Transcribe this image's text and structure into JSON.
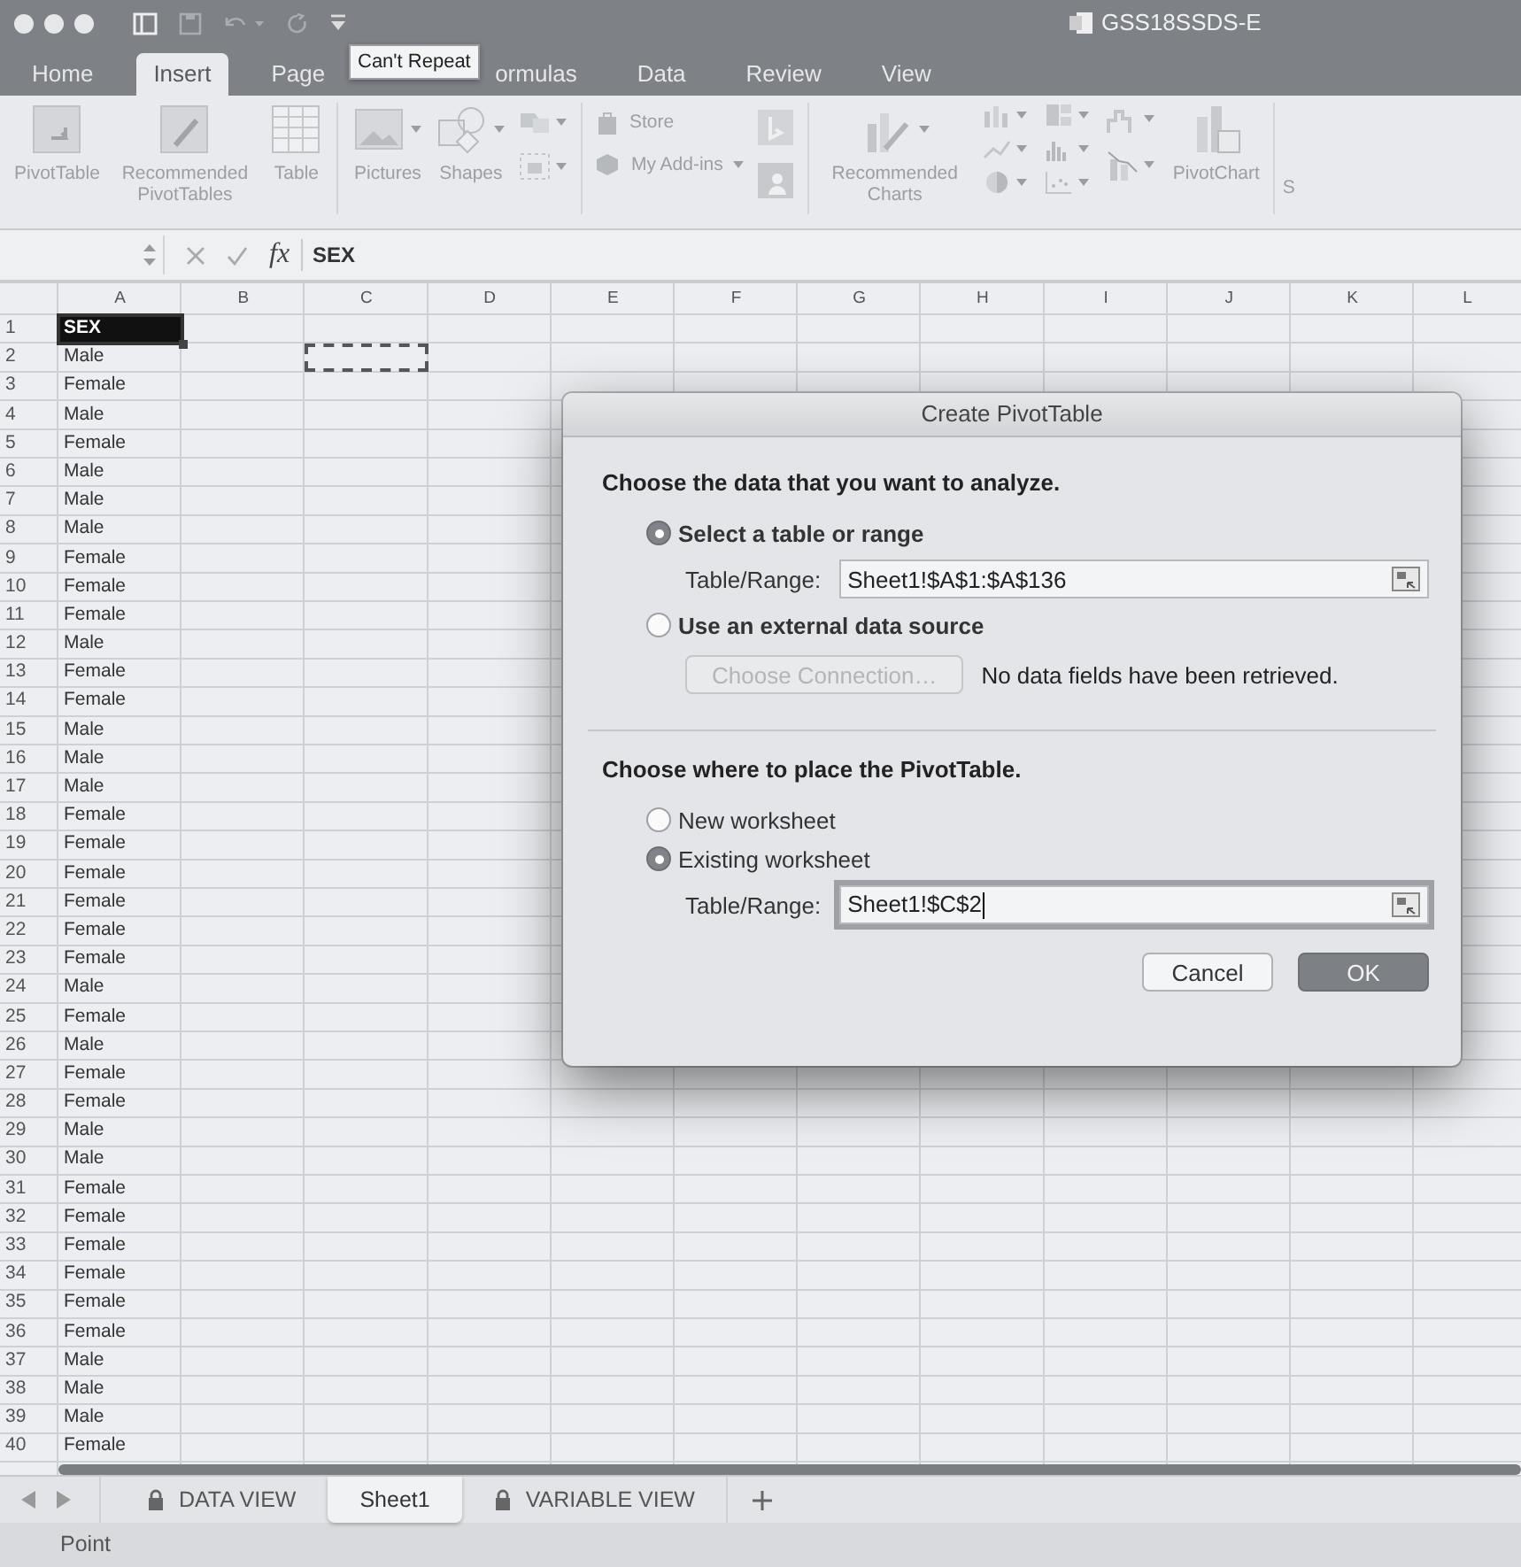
{
  "window": {
    "title": "GSS18SSDS-E"
  },
  "tooltip": "Can't Repeat",
  "ribbon_tabs": [
    {
      "label": "Home",
      "selected": false
    },
    {
      "label": "Insert",
      "selected": true
    },
    {
      "label": "Page",
      "selected": false
    },
    {
      "label": "ormulas",
      "selected": false
    },
    {
      "label": "Data",
      "selected": false
    },
    {
      "label": "Review",
      "selected": false
    },
    {
      "label": "View",
      "selected": false
    }
  ],
  "ribbon": {
    "tables": [
      "PivotTable",
      "Recommended PivotTables",
      "Table"
    ],
    "illustrations": [
      "Pictures",
      "Shapes"
    ],
    "add_ins": [
      "Store",
      "My Add-ins"
    ],
    "charts": [
      "Recommended Charts",
      "PivotChart"
    ],
    "cut_label": "S"
  },
  "formula_bar": {
    "function_symbol": "fx",
    "formula": "SEX"
  },
  "grid": {
    "columns": [
      {
        "label": "A",
        "marquee": false
      },
      {
        "label": "B",
        "marquee": false
      },
      {
        "label": "C",
        "marquee": true
      },
      {
        "label": "D",
        "marquee": false
      },
      {
        "label": "E",
        "marquee": false
      },
      {
        "label": "F",
        "marquee": false
      },
      {
        "label": "G",
        "marquee": false
      },
      {
        "label": "H",
        "marquee": false
      },
      {
        "label": "I",
        "marquee": false
      },
      {
        "label": "J",
        "marquee": false
      },
      {
        "label": "K",
        "marquee": false
      },
      {
        "label": "L",
        "marquee": false
      }
    ],
    "rows": [
      {
        "number": "1",
        "value": "SEX",
        "selected": true
      },
      {
        "number": "2",
        "value": "Male",
        "selected": false,
        "marquee": true
      },
      {
        "number": "3",
        "value": "Female",
        "selected": false
      },
      {
        "number": "4",
        "value": "Male",
        "selected": false
      },
      {
        "number": "5",
        "value": "Female",
        "selected": false
      },
      {
        "number": "6",
        "value": "Male",
        "selected": false
      },
      {
        "number": "7",
        "value": "Male",
        "selected": false
      },
      {
        "number": "8",
        "value": "Male",
        "selected": false
      },
      {
        "number": "9",
        "value": "Female",
        "selected": false
      },
      {
        "number": "10",
        "value": "Female",
        "selected": false
      },
      {
        "number": "11",
        "value": "Female",
        "selected": false
      },
      {
        "number": "12",
        "value": "Male",
        "selected": false
      },
      {
        "number": "13",
        "value": "Female",
        "selected": false
      },
      {
        "number": "14",
        "value": "Female",
        "selected": false
      },
      {
        "number": "15",
        "value": "Male",
        "selected": false
      },
      {
        "number": "16",
        "value": "Male",
        "selected": false
      },
      {
        "number": "17",
        "value": "Male",
        "selected": false
      },
      {
        "number": "18",
        "value": "Female",
        "selected": false
      },
      {
        "number": "19",
        "value": "Female",
        "selected": false
      },
      {
        "number": "20",
        "value": "Female",
        "selected": false
      },
      {
        "number": "21",
        "value": "Female",
        "selected": false
      },
      {
        "number": "22",
        "value": "Female",
        "selected": false
      },
      {
        "number": "23",
        "value": "Female",
        "selected": false
      },
      {
        "number": "24",
        "value": "Male",
        "selected": false
      },
      {
        "number": "25",
        "value": "Female",
        "selected": false
      },
      {
        "number": "26",
        "value": "Male",
        "selected": false
      },
      {
        "number": "27",
        "value": "Female",
        "selected": false
      },
      {
        "number": "28",
        "value": "Female",
        "selected": false
      },
      {
        "number": "29",
        "value": "Male",
        "selected": false
      },
      {
        "number": "30",
        "value": "Male",
        "selected": false
      },
      {
        "number": "31",
        "value": "Female",
        "selected": false
      },
      {
        "number": "32",
        "value": "Female",
        "selected": false
      },
      {
        "number": "33",
        "value": "Female",
        "selected": false
      },
      {
        "number": "34",
        "value": "Female",
        "selected": false
      },
      {
        "number": "35",
        "value": "Female",
        "selected": false
      },
      {
        "number": "36",
        "value": "Female",
        "selected": false
      },
      {
        "number": "37",
        "value": "Male",
        "selected": false
      },
      {
        "number": "38",
        "value": "Male",
        "selected": false
      },
      {
        "number": "39",
        "value": "Male",
        "selected": false
      },
      {
        "number": "40",
        "value": "Female",
        "selected": false
      }
    ]
  },
  "dialog": {
    "title": "Create PivotTable",
    "source": {
      "heading": "Choose the data that you want to analyze.",
      "options": [
        {
          "label": "Select a table or range",
          "selected": true
        },
        {
          "label": "Use an external data source",
          "selected": false
        }
      ],
      "range_label": "Table/Range:",
      "range_value": "Sheet1!$A$1:$A$136",
      "connection_button": {
        "label": "Choose Connection…",
        "disabled": true
      },
      "connection_note": "No data fields have been retrieved."
    },
    "destination": {
      "heading": "Choose where to place the PivotTable.",
      "options": [
        {
          "label": "New worksheet",
          "selected": false
        },
        {
          "label": "Existing worksheet",
          "selected": true
        }
      ],
      "range_label": "Table/Range:",
      "range_value": "Sheet1!$C$2"
    },
    "buttons": [
      {
        "label": "Cancel",
        "default": false
      },
      {
        "label": "OK",
        "default": true
      }
    ]
  },
  "sheet_tabs": [
    {
      "label": "DATA VIEW",
      "locked": true,
      "selected": false
    },
    {
      "label": "Sheet1",
      "locked": false,
      "selected": true
    },
    {
      "label": "VARIABLE VIEW",
      "locked": true,
      "selected": false
    }
  ],
  "status_bar": {
    "mode": "Point"
  }
}
